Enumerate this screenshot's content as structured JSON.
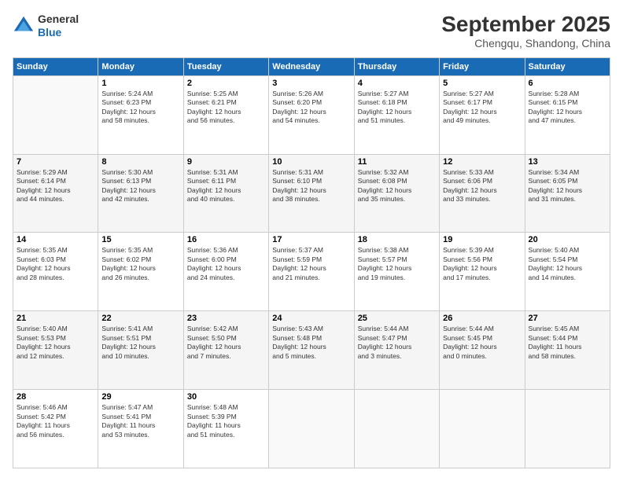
{
  "header": {
    "logo_line1": "General",
    "logo_line2": "Blue",
    "month": "September 2025",
    "location": "Chengqu, Shandong, China"
  },
  "weekdays": [
    "Sunday",
    "Monday",
    "Tuesday",
    "Wednesday",
    "Thursday",
    "Friday",
    "Saturday"
  ],
  "weeks": [
    [
      {
        "day": "",
        "info": ""
      },
      {
        "day": "1",
        "info": "Sunrise: 5:24 AM\nSunset: 6:23 PM\nDaylight: 12 hours\nand 58 minutes."
      },
      {
        "day": "2",
        "info": "Sunrise: 5:25 AM\nSunset: 6:21 PM\nDaylight: 12 hours\nand 56 minutes."
      },
      {
        "day": "3",
        "info": "Sunrise: 5:26 AM\nSunset: 6:20 PM\nDaylight: 12 hours\nand 54 minutes."
      },
      {
        "day": "4",
        "info": "Sunrise: 5:27 AM\nSunset: 6:18 PM\nDaylight: 12 hours\nand 51 minutes."
      },
      {
        "day": "5",
        "info": "Sunrise: 5:27 AM\nSunset: 6:17 PM\nDaylight: 12 hours\nand 49 minutes."
      },
      {
        "day": "6",
        "info": "Sunrise: 5:28 AM\nSunset: 6:15 PM\nDaylight: 12 hours\nand 47 minutes."
      }
    ],
    [
      {
        "day": "7",
        "info": "Sunrise: 5:29 AM\nSunset: 6:14 PM\nDaylight: 12 hours\nand 44 minutes."
      },
      {
        "day": "8",
        "info": "Sunrise: 5:30 AM\nSunset: 6:13 PM\nDaylight: 12 hours\nand 42 minutes."
      },
      {
        "day": "9",
        "info": "Sunrise: 5:31 AM\nSunset: 6:11 PM\nDaylight: 12 hours\nand 40 minutes."
      },
      {
        "day": "10",
        "info": "Sunrise: 5:31 AM\nSunset: 6:10 PM\nDaylight: 12 hours\nand 38 minutes."
      },
      {
        "day": "11",
        "info": "Sunrise: 5:32 AM\nSunset: 6:08 PM\nDaylight: 12 hours\nand 35 minutes."
      },
      {
        "day": "12",
        "info": "Sunrise: 5:33 AM\nSunset: 6:06 PM\nDaylight: 12 hours\nand 33 minutes."
      },
      {
        "day": "13",
        "info": "Sunrise: 5:34 AM\nSunset: 6:05 PM\nDaylight: 12 hours\nand 31 minutes."
      }
    ],
    [
      {
        "day": "14",
        "info": "Sunrise: 5:35 AM\nSunset: 6:03 PM\nDaylight: 12 hours\nand 28 minutes."
      },
      {
        "day": "15",
        "info": "Sunrise: 5:35 AM\nSunset: 6:02 PM\nDaylight: 12 hours\nand 26 minutes."
      },
      {
        "day": "16",
        "info": "Sunrise: 5:36 AM\nSunset: 6:00 PM\nDaylight: 12 hours\nand 24 minutes."
      },
      {
        "day": "17",
        "info": "Sunrise: 5:37 AM\nSunset: 5:59 PM\nDaylight: 12 hours\nand 21 minutes."
      },
      {
        "day": "18",
        "info": "Sunrise: 5:38 AM\nSunset: 5:57 PM\nDaylight: 12 hours\nand 19 minutes."
      },
      {
        "day": "19",
        "info": "Sunrise: 5:39 AM\nSunset: 5:56 PM\nDaylight: 12 hours\nand 17 minutes."
      },
      {
        "day": "20",
        "info": "Sunrise: 5:40 AM\nSunset: 5:54 PM\nDaylight: 12 hours\nand 14 minutes."
      }
    ],
    [
      {
        "day": "21",
        "info": "Sunrise: 5:40 AM\nSunset: 5:53 PM\nDaylight: 12 hours\nand 12 minutes."
      },
      {
        "day": "22",
        "info": "Sunrise: 5:41 AM\nSunset: 5:51 PM\nDaylight: 12 hours\nand 10 minutes."
      },
      {
        "day": "23",
        "info": "Sunrise: 5:42 AM\nSunset: 5:50 PM\nDaylight: 12 hours\nand 7 minutes."
      },
      {
        "day": "24",
        "info": "Sunrise: 5:43 AM\nSunset: 5:48 PM\nDaylight: 12 hours\nand 5 minutes."
      },
      {
        "day": "25",
        "info": "Sunrise: 5:44 AM\nSunset: 5:47 PM\nDaylight: 12 hours\nand 3 minutes."
      },
      {
        "day": "26",
        "info": "Sunrise: 5:44 AM\nSunset: 5:45 PM\nDaylight: 12 hours\nand 0 minutes."
      },
      {
        "day": "27",
        "info": "Sunrise: 5:45 AM\nSunset: 5:44 PM\nDaylight: 11 hours\nand 58 minutes."
      }
    ],
    [
      {
        "day": "28",
        "info": "Sunrise: 5:46 AM\nSunset: 5:42 PM\nDaylight: 11 hours\nand 56 minutes."
      },
      {
        "day": "29",
        "info": "Sunrise: 5:47 AM\nSunset: 5:41 PM\nDaylight: 11 hours\nand 53 minutes."
      },
      {
        "day": "30",
        "info": "Sunrise: 5:48 AM\nSunset: 5:39 PM\nDaylight: 11 hours\nand 51 minutes."
      },
      {
        "day": "",
        "info": ""
      },
      {
        "day": "",
        "info": ""
      },
      {
        "day": "",
        "info": ""
      },
      {
        "day": "",
        "info": ""
      }
    ]
  ]
}
